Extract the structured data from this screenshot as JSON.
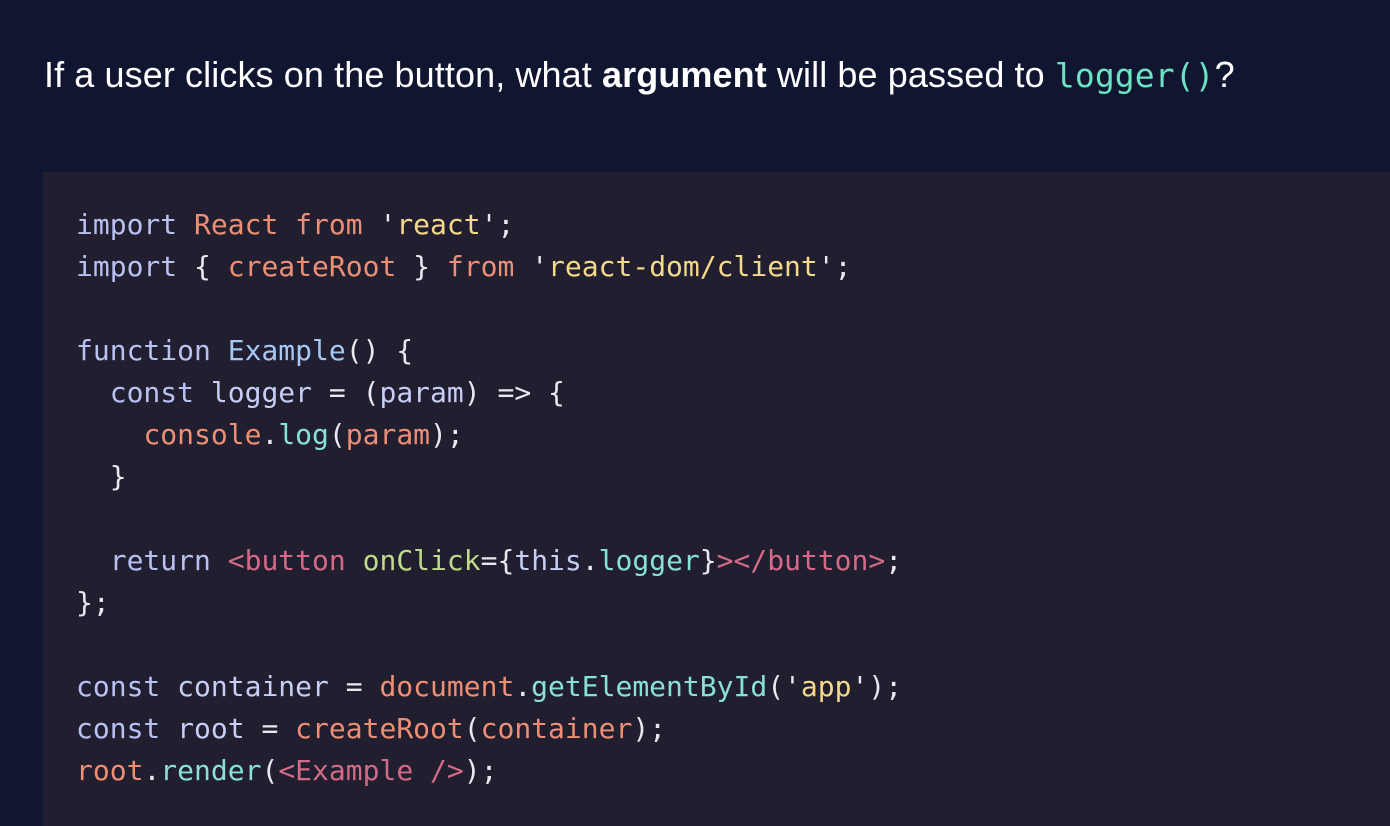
{
  "question": {
    "part1": "If a user clicks on the button, what ",
    "emphasis": "argument",
    "part2": " will be passed to ",
    "code": "logger()",
    "part3": "?"
  },
  "code_block": {
    "language": "jsx",
    "lines": [
      [
        {
          "t": "import",
          "c": "kw"
        },
        {
          "t": " ",
          "c": "punc"
        },
        {
          "t": "React",
          "c": "id"
        },
        {
          "t": " ",
          "c": "punc"
        },
        {
          "t": "from",
          "c": "id"
        },
        {
          "t": " ",
          "c": "punc"
        },
        {
          "t": "'",
          "c": "punc"
        },
        {
          "t": "react",
          "c": "str"
        },
        {
          "t": "'",
          "c": "punc"
        },
        {
          "t": ";",
          "c": "punc"
        }
      ],
      [
        {
          "t": "import",
          "c": "kw"
        },
        {
          "t": " { ",
          "c": "punc"
        },
        {
          "t": "createRoot",
          "c": "id"
        },
        {
          "t": " } ",
          "c": "punc"
        },
        {
          "t": "from",
          "c": "id"
        },
        {
          "t": " ",
          "c": "punc"
        },
        {
          "t": "'",
          "c": "punc"
        },
        {
          "t": "react-dom/client",
          "c": "str"
        },
        {
          "t": "'",
          "c": "punc"
        },
        {
          "t": ";",
          "c": "punc"
        }
      ],
      [],
      [
        {
          "t": "function",
          "c": "kw"
        },
        {
          "t": " ",
          "c": "punc"
        },
        {
          "t": "Example",
          "c": "fn"
        },
        {
          "t": "() {",
          "c": "punc"
        }
      ],
      [
        {
          "t": "  ",
          "c": "punc"
        },
        {
          "t": "const",
          "c": "kw"
        },
        {
          "t": " ",
          "c": "punc"
        },
        {
          "t": "logger",
          "c": "plain"
        },
        {
          "t": " = (",
          "c": "punc"
        },
        {
          "t": "param",
          "c": "plain"
        },
        {
          "t": ") => {",
          "c": "punc"
        }
      ],
      [
        {
          "t": "    ",
          "c": "punc"
        },
        {
          "t": "console",
          "c": "id"
        },
        {
          "t": ".",
          "c": "punc"
        },
        {
          "t": "log",
          "c": "meth"
        },
        {
          "t": "(",
          "c": "punc"
        },
        {
          "t": "param",
          "c": "id"
        },
        {
          "t": ");",
          "c": "punc"
        }
      ],
      [
        {
          "t": "  }",
          "c": "punc"
        }
      ],
      [],
      [
        {
          "t": "  ",
          "c": "punc"
        },
        {
          "t": "return",
          "c": "kw"
        },
        {
          "t": " ",
          "c": "punc"
        },
        {
          "t": "<button",
          "c": "tag"
        },
        {
          "t": " ",
          "c": "punc"
        },
        {
          "t": "onClick",
          "c": "attr"
        },
        {
          "t": "={",
          "c": "punc"
        },
        {
          "t": "this",
          "c": "plain"
        },
        {
          "t": ".",
          "c": "punc"
        },
        {
          "t": "logger",
          "c": "meth"
        },
        {
          "t": "}",
          "c": "punc"
        },
        {
          "t": "></button>",
          "c": "tag"
        },
        {
          "t": ";",
          "c": "punc"
        }
      ],
      [
        {
          "t": "};",
          "c": "punc"
        }
      ],
      [],
      [
        {
          "t": "const",
          "c": "kw"
        },
        {
          "t": " ",
          "c": "punc"
        },
        {
          "t": "container",
          "c": "plain"
        },
        {
          "t": " = ",
          "c": "punc"
        },
        {
          "t": "document",
          "c": "id"
        },
        {
          "t": ".",
          "c": "punc"
        },
        {
          "t": "getElementById",
          "c": "meth"
        },
        {
          "t": "(",
          "c": "punc"
        },
        {
          "t": "'",
          "c": "punc"
        },
        {
          "t": "app",
          "c": "str"
        },
        {
          "t": "'",
          "c": "punc"
        },
        {
          "t": ");",
          "c": "punc"
        }
      ],
      [
        {
          "t": "const",
          "c": "kw"
        },
        {
          "t": " ",
          "c": "punc"
        },
        {
          "t": "root",
          "c": "plain"
        },
        {
          "t": " = ",
          "c": "punc"
        },
        {
          "t": "createRoot",
          "c": "id"
        },
        {
          "t": "(",
          "c": "punc"
        },
        {
          "t": "container",
          "c": "id"
        },
        {
          "t": ");",
          "c": "punc"
        }
      ],
      [
        {
          "t": "root",
          "c": "id"
        },
        {
          "t": ".",
          "c": "punc"
        },
        {
          "t": "render",
          "c": "meth"
        },
        {
          "t": "(",
          "c": "punc"
        },
        {
          "t": "<Example />",
          "c": "tag"
        },
        {
          "t": ");",
          "c": "punc"
        }
      ]
    ]
  },
  "colors": {
    "background": "#111630",
    "code_panel": "#201e2f",
    "question_text": "#ffffff",
    "inline_code": "#6ce3c3",
    "keyword": "#b9c1f2",
    "identifier": "#ec8f74",
    "string": "#f5d98b",
    "function": "#a6c8f5",
    "method": "#89e0d4",
    "tag": "#d36a86",
    "attribute": "#c0d98a"
  }
}
